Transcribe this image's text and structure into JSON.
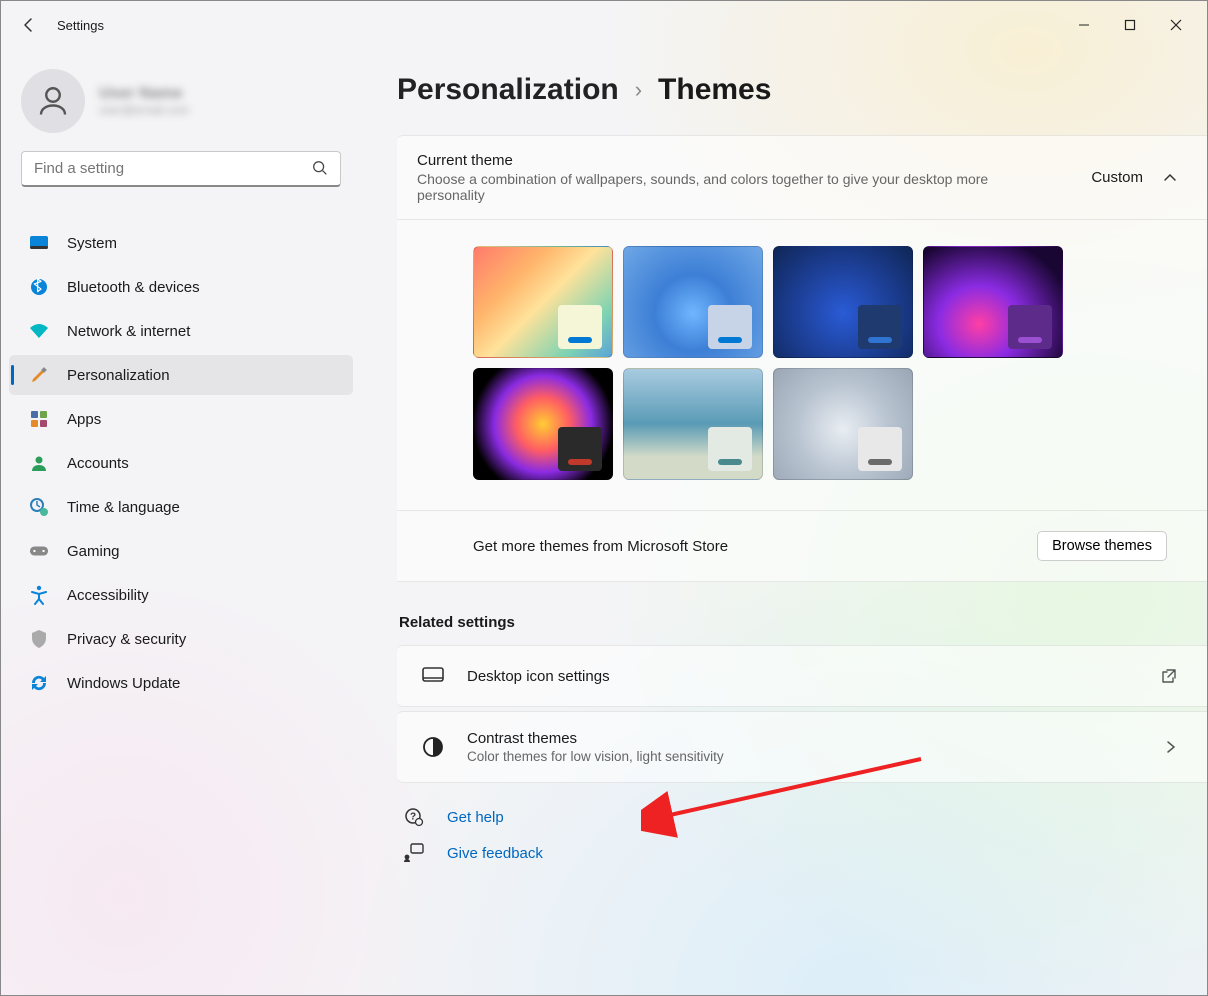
{
  "app": {
    "title": "Settings"
  },
  "user": {
    "name": "User Name",
    "email": "user@email.com"
  },
  "search": {
    "placeholder": "Find a setting"
  },
  "nav": {
    "items": [
      {
        "label": "System"
      },
      {
        "label": "Bluetooth & devices"
      },
      {
        "label": "Network & internet"
      },
      {
        "label": "Personalization"
      },
      {
        "label": "Apps"
      },
      {
        "label": "Accounts"
      },
      {
        "label": "Time & language"
      },
      {
        "label": "Gaming"
      },
      {
        "label": "Accessibility"
      },
      {
        "label": "Privacy & security"
      },
      {
        "label": "Windows Update"
      }
    ],
    "active_index": 3
  },
  "breadcrumb": {
    "parent": "Personalization",
    "current": "Themes"
  },
  "theme_panel": {
    "title": "Current theme",
    "desc": "Choose a combination of wallpapers, sounds, and colors together to give your desktop more personality",
    "value": "Custom",
    "store_label": "Get more themes from Microsoft Store",
    "browse_button": "Browse themes",
    "theme_count": 7
  },
  "related": {
    "title": "Related settings",
    "items": [
      {
        "title": "Desktop icon settings",
        "desc": "",
        "kind": "external"
      },
      {
        "title": "Contrast themes",
        "desc": "Color themes for low vision, light sensitivity",
        "kind": "nav"
      }
    ]
  },
  "help": {
    "get_help": "Get help",
    "give_feedback": "Give feedback"
  }
}
